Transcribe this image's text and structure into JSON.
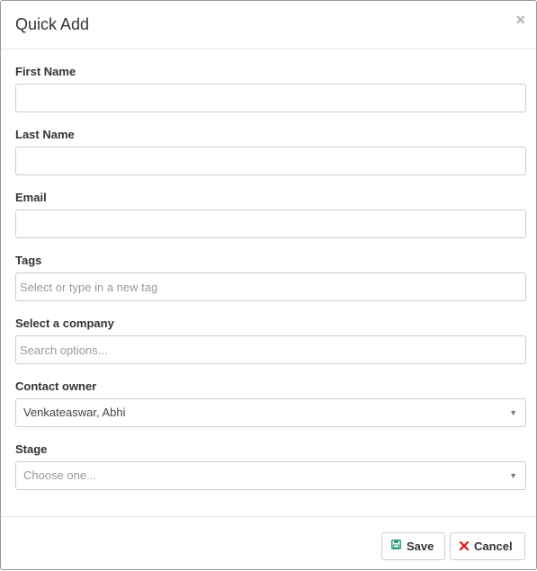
{
  "modal": {
    "title": "Quick Add",
    "close": "×"
  },
  "fields": {
    "first_name": {
      "label": "First Name",
      "value": ""
    },
    "last_name": {
      "label": "Last Name",
      "value": ""
    },
    "email": {
      "label": "Email",
      "value": ""
    },
    "tags": {
      "label": "Tags",
      "placeholder": "Select or type in a new tag"
    },
    "company": {
      "label": "Select a company",
      "placeholder": "Search options..."
    },
    "contact_owner": {
      "label": "Contact owner",
      "value": "Venkateaswar, Abhi"
    },
    "stage": {
      "label": "Stage",
      "placeholder": "Choose one..."
    }
  },
  "footer": {
    "save_label": "Save",
    "cancel_label": "Cancel"
  },
  "icons": {
    "caret": "▼",
    "save": "floppy-disk-icon",
    "cancel": "x-icon"
  },
  "colors": {
    "save_icon": "#2e9e7e",
    "cancel_icon": "#d9292b"
  }
}
